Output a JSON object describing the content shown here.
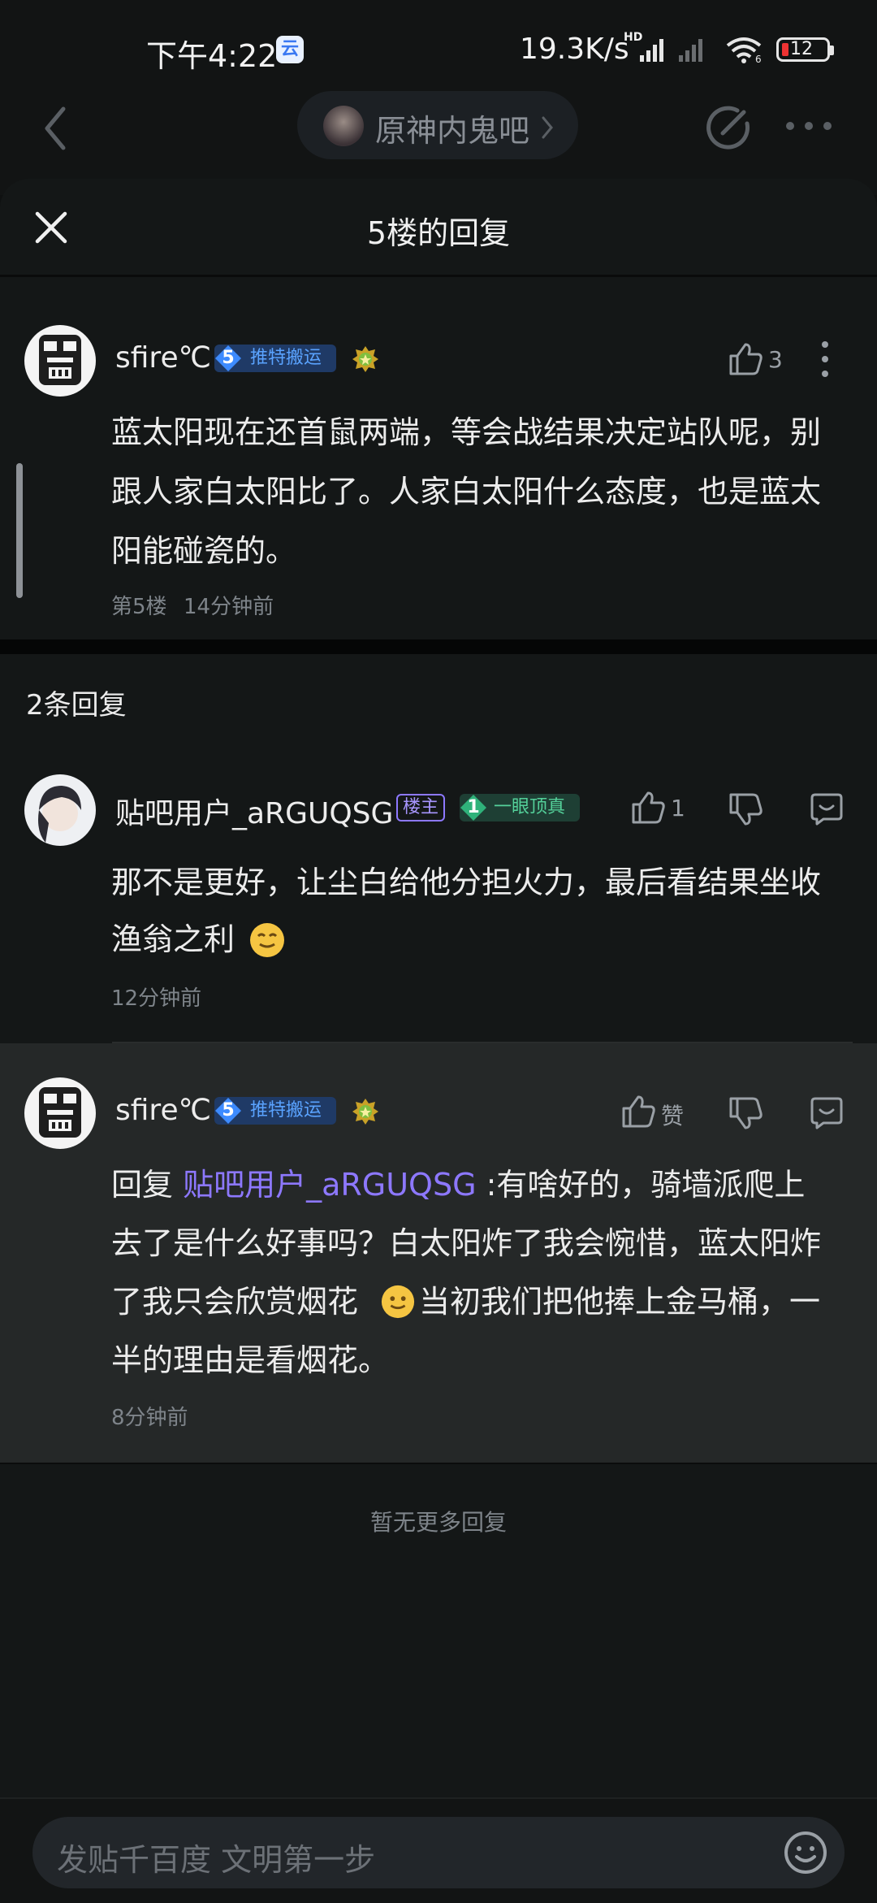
{
  "status_bar": {
    "time": "下午4:22",
    "network_speed": "19.3K/s",
    "hd_badge": "HD",
    "battery": "12",
    "wifi_label": "6"
  },
  "nav": {
    "forum_name": "原神内鬼吧"
  },
  "sheet": {
    "title": "5楼的回复"
  },
  "main_post": {
    "username": "sfire℃",
    "level": "5",
    "level_title": "推特搬运",
    "likes": "3",
    "text_lines": [
      "蓝太阳现在还首鼠两端，等会战结果决定站队呢，别",
      "跟人家白太阳比了。人家白太阳什么态度，也是蓝太",
      "阳能碰瓷的。"
    ],
    "floor": "第5楼",
    "time": "14分钟前"
  },
  "reply_count": "2条回复",
  "replies": [
    {
      "username": "贴吧用户_aRGUQSG",
      "mod_tag": "楼主",
      "level": "1",
      "level_title": "一眼顶真",
      "likes": "1",
      "text_lines": [
        "那不是更好，让尘白给他分担火力，最后看结果坐收",
        "渔翁之利"
      ],
      "time": "12分钟前"
    },
    {
      "username": "sfire℃",
      "level": "5",
      "level_title": "推特搬运",
      "like_label": "赞",
      "reply_prefix": "回复 ",
      "mention": "贴吧用户_aRGUQSG",
      "line1_rest": " :有啥好的，骑墙派爬上",
      "line2": "去了是什么好事吗？白太阳炸了我会惋惜，蓝太阳炸",
      "line3a": "了我只会欣赏烟花 ",
      "line3b": "当初我们把他捧上金马桶，一",
      "line4": "半的理由是看烟花。",
      "time": "8分钟前"
    }
  ],
  "no_more": "暂无更多回复",
  "input": {
    "placeholder": "发贴千百度 文明第一步"
  },
  "colors": {
    "background": "#0f1111",
    "accent_purple": "#8d78ff",
    "level_blue": "#5aa3ff",
    "title_green": "#54d19a"
  },
  "icons": [
    "back-icon",
    "chevron-right-icon",
    "edit-icon",
    "more-icon",
    "close-icon",
    "thumbs-up-icon",
    "thumbs-down-icon",
    "reply-icon",
    "emoji-icon",
    "medal-icon"
  ]
}
